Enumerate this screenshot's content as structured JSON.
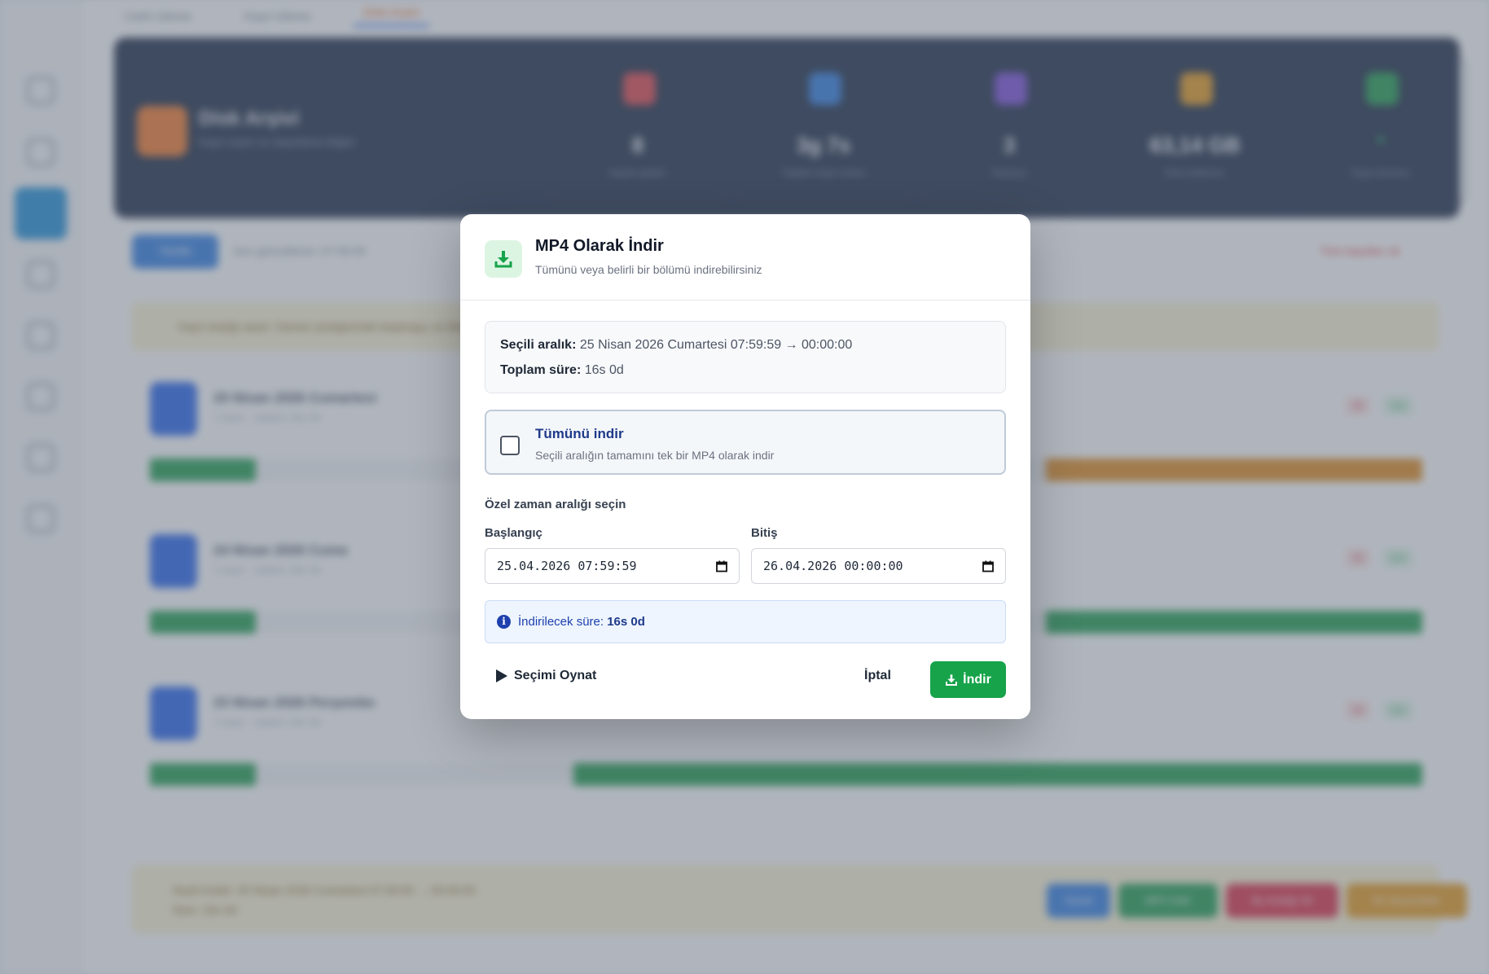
{
  "background": {
    "tabs": [
      {
        "label": "Canlı İzleme"
      },
      {
        "label": "Kayıt İzleme"
      },
      {
        "label": "Disk Arşivi"
      }
    ],
    "hero": {
      "title": "Disk Arşivi",
      "subtitle": "Kayıt arşivi ve depolama bilgisi"
    },
    "stats": [
      {
        "value": "8",
        "label": "Kayıtlı günler",
        "color": "#e0454a"
      },
      {
        "value": "3g 7s",
        "label": "Toplam kayıt süresi",
        "color": "#2f7de1"
      },
      {
        "value": "3",
        "label": "Kamera",
        "color": "#7c4ddb"
      },
      {
        "value": "63,14 GB",
        "label": "Disk kullanımı",
        "color": "#e69a1c"
      },
      {
        "value": "●",
        "label": "Kayıt durumu",
        "color": "#1f9d4d"
      }
    ],
    "controls": {
      "button": "Yenile",
      "status": "Son güncelleme: 07:59:59",
      "right_action": "Tüm kayıtları sil"
    },
    "banner": "Kayıt aralığı seçin: Zaman çizelgesinde başlangıç ve bitiş noktalarını seçin",
    "days": [
      {
        "title": "25 Nisan 2026 Cumartesi",
        "subtitle": "1 kayıt · toplam 16s 0d",
        "tag_red": "Sil",
        "tag_green": "İzle"
      },
      {
        "title": "24 Nisan 2026 Cuma",
        "subtitle": "1 kayıt · toplam 16s 0d",
        "tag_red": "Sil",
        "tag_green": "İzle"
      },
      {
        "title": "23 Nisan 2026 Perşembe",
        "subtitle": "1 kayıt · toplam 16s 0d",
        "tag_red": "Sil",
        "tag_green": "İzle"
      }
    ],
    "footer": {
      "line1": "Seçili Aralık: 25 Nisan 2026 Cumartesi 07:59:59 → 00:00:00",
      "line2": "Süre: 16s 0d",
      "buttons": [
        "Oynat",
        "MP4 İndir",
        "Bu Aralığı Sil",
        "Ek Seçenekler"
      ]
    }
  },
  "modal": {
    "title": "MP4 Olarak İndir",
    "subtitle": "Tümünü veya belirli bir bölümü indirebilirsiniz",
    "selected_range": {
      "label": "Seçili aralık:",
      "value": "25 Nisan 2026 Cumartesi 07:59:59 → 00:00:00"
    },
    "total_duration": {
      "label": "Toplam süre:",
      "value": "16s 0d"
    },
    "download_all": {
      "title": "Tümünü indir",
      "description": "Seçili aralığın tamamını tek bir MP4 olarak indir",
      "checked": false
    },
    "custom_range_label": "Özel zaman aralığı seçin",
    "start": {
      "label": "Başlangıç",
      "value": "25.04.2026 07:59:59"
    },
    "end": {
      "label": "Bitiş",
      "value": "26.04.2026 00:00:00"
    },
    "info": {
      "label": "İndirilecek süre:",
      "value": "16s 0d"
    },
    "buttons": {
      "play_selection": "Seçimi Oynat",
      "cancel": "İptal",
      "download": "İndir"
    },
    "colors": {
      "accent_green": "#16a34a",
      "info_blue": "#1e40af"
    }
  }
}
